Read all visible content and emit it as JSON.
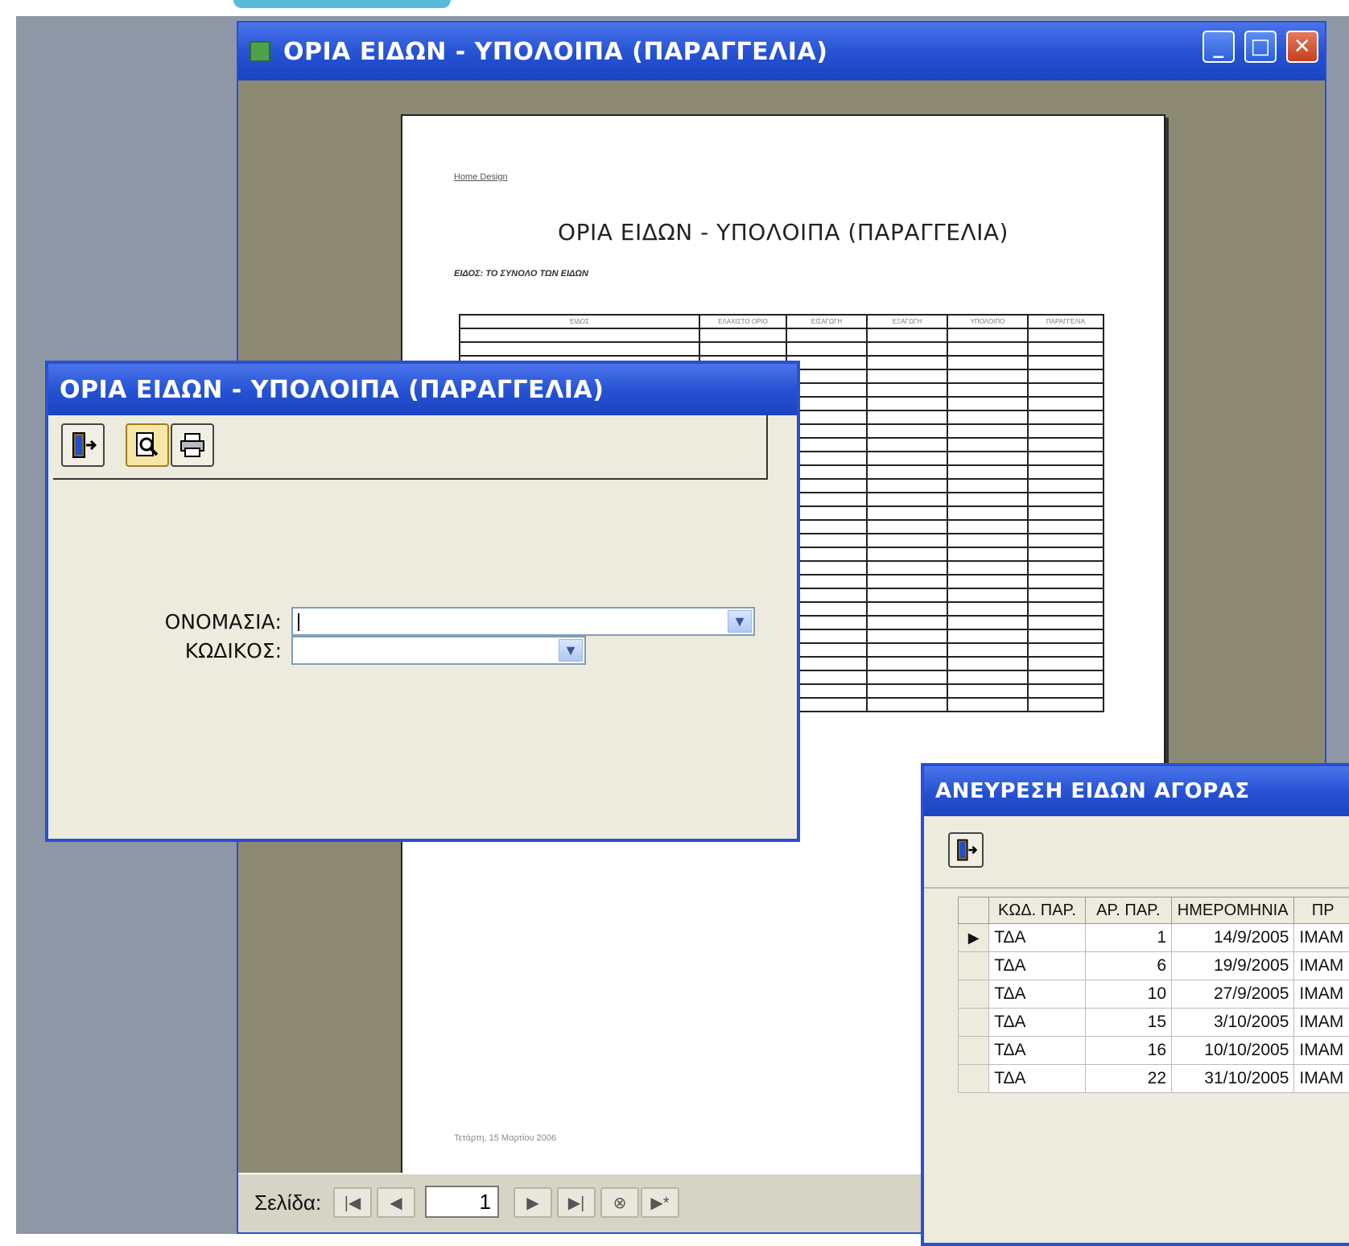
{
  "preview_window": {
    "title": "ΟΡΙΑ ΕΙΔΩΝ - ΥΠΟΛΟΙΠΑ (ΠΑΡΑΓΓΕΛΙΑ)",
    "controls": {
      "minimize": "_",
      "maximize": "□",
      "close": "✕"
    },
    "report": {
      "company": "Home Design",
      "title": "ΟΡΙΑ ΕΙΔΩΝ - ΥΠΟΛΟΙΠΑ (ΠΑΡΑΓΓΕΛΙΑ)",
      "subtitle": "ΕΙΔΟΣ: ΤΟ ΣΥΝΟΛΟ ΤΩΝ ΕΙΔΩΝ",
      "columns": [
        "ΕΙΔΟΣ",
        "ΕΛΑΧΙΣΤΟ ΟΡΙΟ",
        "ΕΙΣΑΓΩΓΗ",
        "ΕΞΑΓΩΓΗ",
        "ΥΠΟΛΟΙΠΟ",
        "ΠΑΡΑΓΓΕΛΙΑ"
      ],
      "footer": "Τετάρτη, 15 Μαρτίου 2006"
    },
    "pager": {
      "label": "Σελίδα:",
      "page": "1",
      "first": "|◀",
      "prev": "◀",
      "next": "▶",
      "last": "▶|",
      "stop": "⊗",
      "new": "▶*"
    }
  },
  "filter_dialog": {
    "title": "ΟΡΙΑ ΕΙΔΩΝ - ΥΠΟΛΟΙΠΑ (ΠΑΡΑΓΓΕΛΙΑ)",
    "fields": {
      "name_label": "ΟΝΟΜΑΣΙΑ:",
      "name_value": "",
      "code_label": "ΚΩΔΙΚΟΣ:",
      "code_value": ""
    }
  },
  "purchases_window": {
    "title": "ΑΝΕΥΡΕΣΗ ΕΙΔΩΝ ΑΓΟΡΑΣ",
    "columns": [
      "ΚΩΔ. ΠΑΡ.",
      "ΑΡ. ΠΑΡ.",
      "ΗΜΕΡΟΜΗΝΙΑ",
      "ΠΡ"
    ],
    "rows": [
      {
        "code": "ΤΔΑ",
        "num": "1",
        "date": "14/9/2005",
        "sup": "ΙΜΑΜ"
      },
      {
        "code": "ΤΔΑ",
        "num": "6",
        "date": "19/9/2005",
        "sup": "ΙΜΑΜ"
      },
      {
        "code": "ΤΔΑ",
        "num": "10",
        "date": "27/9/2005",
        "sup": "ΙΜΑΜ"
      },
      {
        "code": "ΤΔΑ",
        "num": "15",
        "date": "3/10/2005",
        "sup": "ΙΜΑΜ"
      },
      {
        "code": "ΤΔΑ",
        "num": "16",
        "date": "10/10/2005",
        "sup": "ΙΜΑΜ"
      },
      {
        "code": "ΤΔΑ",
        "num": "22",
        "date": "31/10/2005",
        "sup": "ΙΜΑΜ"
      }
    ]
  },
  "colors": {
    "title_blue": "#2451d2",
    "dialog_bg": "#ecebdd",
    "desktop": "#8e97a6"
  }
}
